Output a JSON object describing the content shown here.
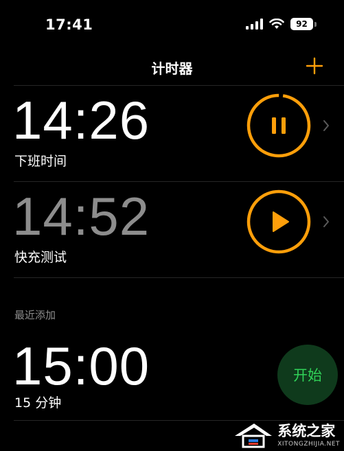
{
  "status_bar": {
    "time": "17:41",
    "battery": "92",
    "icons": [
      "cellular-signal-icon",
      "wifi-icon",
      "battery-icon"
    ]
  },
  "nav": {
    "title": "计时器",
    "add_icon": "plus-icon"
  },
  "timers": [
    {
      "time": "14:26",
      "label": "下班时间",
      "state": "running",
      "control_icon": "pause-icon",
      "progress_remaining": 0.98
    },
    {
      "time": "14:52",
      "label": "快充测试",
      "state": "paused",
      "control_icon": "play-icon",
      "progress_remaining": 1.0
    }
  ],
  "recent": {
    "header": "最近添加",
    "items": [
      {
        "time": "15:00",
        "label": "15 分钟",
        "action_label": "开始"
      }
    ]
  },
  "watermark": {
    "text": "系统之家",
    "url": "XITONGZHIJIA.NET"
  },
  "colors": {
    "accent": "#ff9f0a",
    "start_green": "#30d158",
    "start_bg": "#0f3a1c",
    "background": "#000000",
    "secondary_text": "#8d8d8d"
  }
}
